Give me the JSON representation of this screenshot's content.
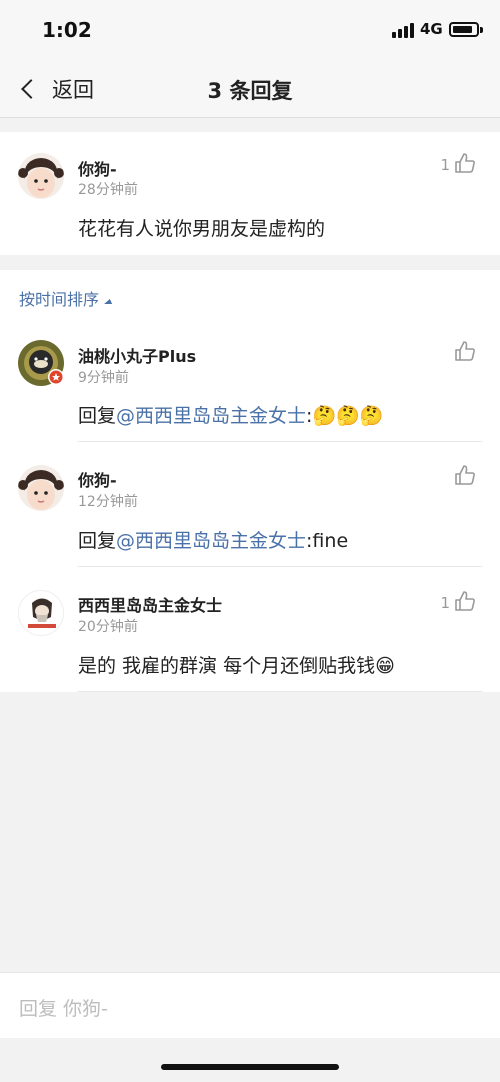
{
  "status_bar": {
    "time": "1:02",
    "network": "4G"
  },
  "nav": {
    "back_label": "返回",
    "title": "3 条回复"
  },
  "original_comment": {
    "username": "你狗-",
    "time": "28分钟前",
    "text": "花花有人说你男朋友是虚构的",
    "likes": "1"
  },
  "sort": {
    "label": "按时间排序"
  },
  "replies": [
    {
      "username": "油桃小丸子Plus",
      "time": "9分钟前",
      "prefix": "回复",
      "mention": "@西西里岛岛主金女士",
      "suffix": ":",
      "emojis": "🤔🤔🤔",
      "likes": ""
    },
    {
      "username": "你狗-",
      "time": "12分钟前",
      "prefix": "回复",
      "mention": "@西西里岛岛主金女士",
      "suffix": ":fine",
      "emojis": "",
      "likes": ""
    },
    {
      "username": "西西里岛岛主金女士",
      "time": "20分钟前",
      "prefix": "是的 我雇的群演 每个月还倒贴我钱",
      "mention": "",
      "suffix": "",
      "emojis": "😁",
      "likes": "1"
    }
  ],
  "reply_bar": {
    "placeholder": "回复 你狗-"
  },
  "colors": {
    "link": "#4a72a8",
    "muted": "#999999",
    "background": "#f2f2f2"
  }
}
